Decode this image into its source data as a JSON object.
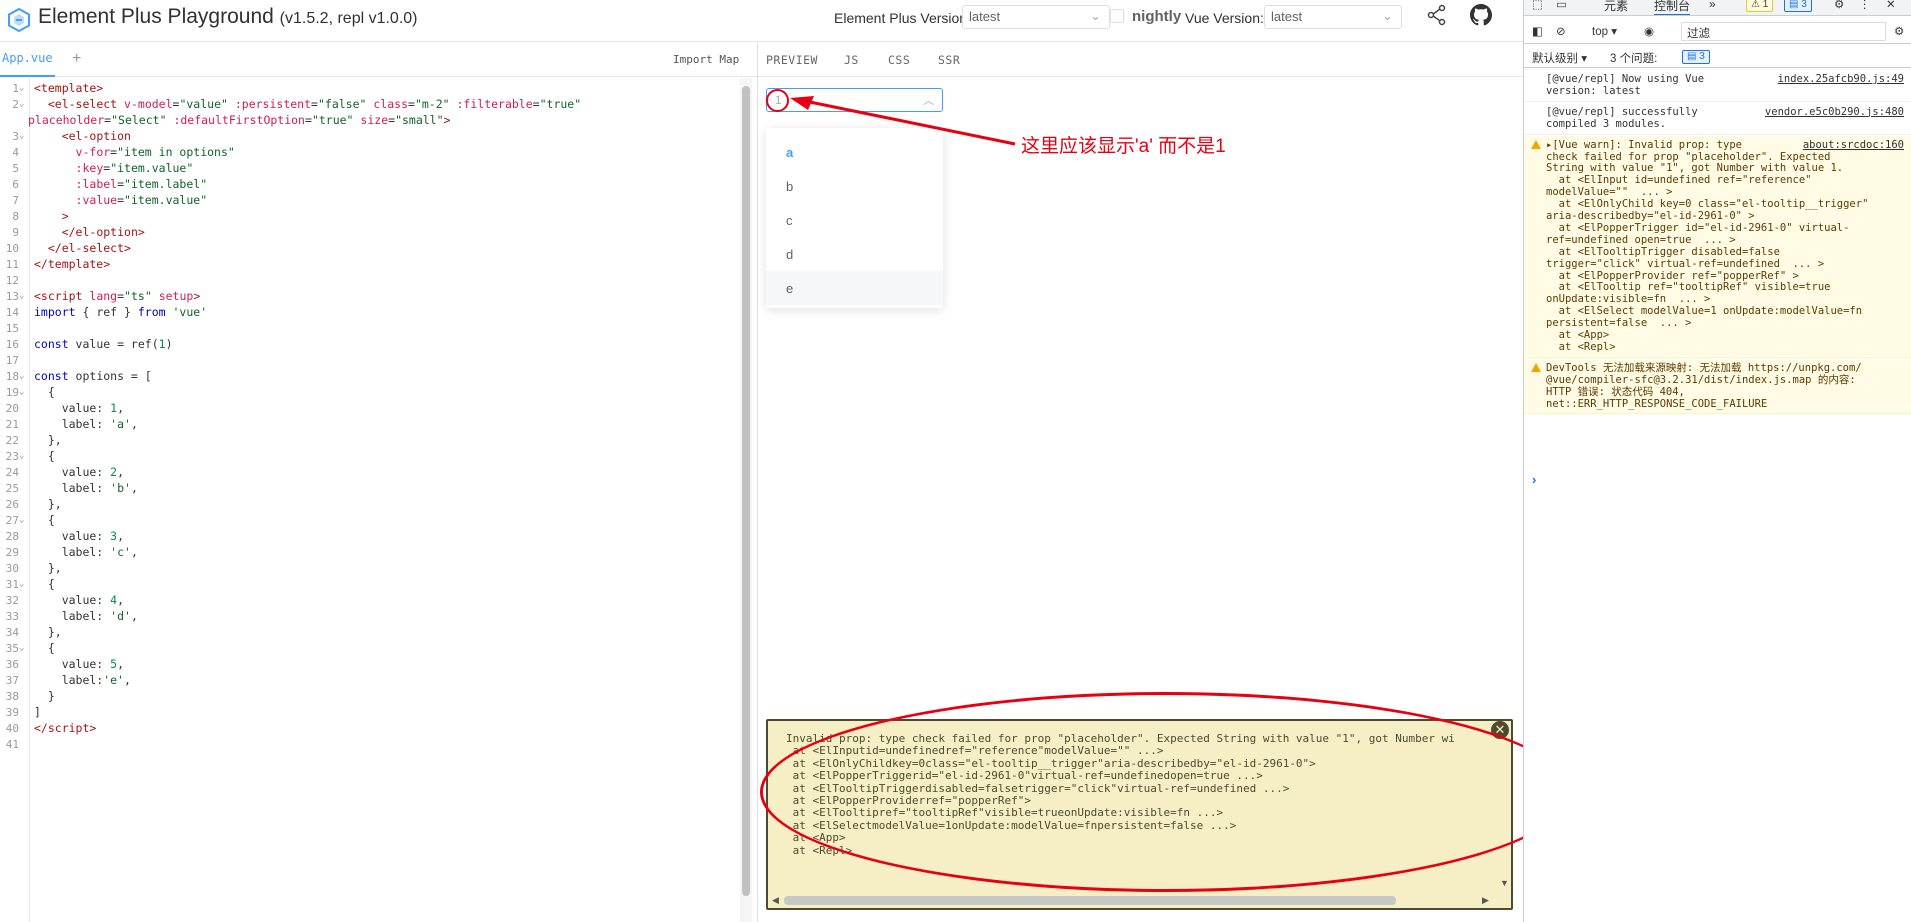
{
  "header": {
    "title": "Element Plus Playground",
    "version": "(v1.5.2, repl v1.0.0)",
    "ep_version_label": "Element Plus Version:",
    "ep_version_value": "latest",
    "nightly_label": "nightly",
    "vue_version_label": "Vue Version:",
    "vue_version_value": "latest"
  },
  "editor": {
    "file_tab": "App.vue",
    "add_label": "+",
    "import_map": "Import Map",
    "lines": [
      {
        "n": "1",
        "fold": true,
        "html": "<span class='tag'>&lt;template&gt;</span>"
      },
      {
        "n": "2",
        "fold": true,
        "html": "  <span class='tag'>&lt;el-select</span> <span class='attr'>v-model</span>=<span class='str'>\"value\"</span> <span class='attr'>:persistent</span>=<span class='str'>\"false\"</span> <span class='attr'>class</span>=<span class='str'>\"m-2\"</span> <span class='attr'>:filterable</span>=<span class='str'>\"true\"</span>"
      },
      {
        "n": "",
        "fold": false,
        "wrap": true,
        "html": "<span class='attr'>placeholder</span>=<span class='str'>\"Select\"</span> <span class='attr'>:defaultFirstOption</span>=<span class='str'>\"true\"</span> <span class='attr'>size</span>=<span class='str'>\"small\"</span><span class='tag'>&gt;</span>"
      },
      {
        "n": "3",
        "fold": true,
        "html": "    <span class='tag'>&lt;el-option</span>"
      },
      {
        "n": "4",
        "fold": false,
        "html": "      <span class='attr'>v-for</span>=<span class='str'>\"item in options\"</span>"
      },
      {
        "n": "5",
        "fold": false,
        "html": "      <span class='attr'>:key</span>=<span class='str'>\"item.value\"</span>"
      },
      {
        "n": "6",
        "fold": false,
        "html": "      <span class='attr'>:label</span>=<span class='str'>\"item.label\"</span>"
      },
      {
        "n": "7",
        "fold": false,
        "html": "      <span class='attr'>:value</span>=<span class='str'>\"item.value\"</span>"
      },
      {
        "n": "8",
        "fold": false,
        "html": "    <span class='tag'>&gt;</span>"
      },
      {
        "n": "9",
        "fold": false,
        "html": "    <span class='tag'>&lt;/el-option&gt;</span>"
      },
      {
        "n": "10",
        "fold": false,
        "html": "  <span class='tag'>&lt;/el-select&gt;</span>"
      },
      {
        "n": "11",
        "fold": false,
        "html": "<span class='tag'>&lt;/template&gt;</span>"
      },
      {
        "n": "12",
        "fold": false,
        "html": ""
      },
      {
        "n": "13",
        "fold": true,
        "html": "<span class='tag'>&lt;script</span> <span class='attr'>lang</span>=<span class='str'>\"ts\"</span> <span class='attr'>setup</span><span class='tag'>&gt;</span>"
      },
      {
        "n": "14",
        "fold": false,
        "html": "<span class='kw'>import</span> { ref } <span class='kw'>from</span> <span class='str'>'vue'</span>"
      },
      {
        "n": "15",
        "fold": false,
        "html": ""
      },
      {
        "n": "16",
        "fold": false,
        "html": "<span class='kw'>const</span> value = ref(<span class='num'>1</span>)"
      },
      {
        "n": "17",
        "fold": false,
        "html": ""
      },
      {
        "n": "18",
        "fold": true,
        "html": "<span class='kw'>const</span> options = ["
      },
      {
        "n": "19",
        "fold": true,
        "html": "  {"
      },
      {
        "n": "20",
        "fold": false,
        "html": "    value: <span class='num'>1</span>,"
      },
      {
        "n": "21",
        "fold": false,
        "html": "    label: <span class='str'>'a'</span>,"
      },
      {
        "n": "22",
        "fold": false,
        "html": "  },"
      },
      {
        "n": "23",
        "fold": true,
        "html": "  {"
      },
      {
        "n": "24",
        "fold": false,
        "html": "    value: <span class='num'>2</span>,"
      },
      {
        "n": "25",
        "fold": false,
        "html": "    label: <span class='str'>'b'</span>,"
      },
      {
        "n": "26",
        "fold": false,
        "html": "  },"
      },
      {
        "n": "27",
        "fold": true,
        "html": "  {"
      },
      {
        "n": "28",
        "fold": false,
        "html": "    value: <span class='num'>3</span>,"
      },
      {
        "n": "29",
        "fold": false,
        "html": "    label: <span class='str'>'c'</span>,"
      },
      {
        "n": "30",
        "fold": false,
        "html": "  },"
      },
      {
        "n": "31",
        "fold": true,
        "html": "  {"
      },
      {
        "n": "32",
        "fold": false,
        "html": "    value: <span class='num'>4</span>,"
      },
      {
        "n": "33",
        "fold": false,
        "html": "    label: <span class='str'>'d'</span>,"
      },
      {
        "n": "34",
        "fold": false,
        "html": "  },"
      },
      {
        "n": "35",
        "fold": true,
        "html": "  {"
      },
      {
        "n": "36",
        "fold": false,
        "html": "    value: <span class='num'>5</span>,"
      },
      {
        "n": "37",
        "fold": false,
        "html": "    label:<span class='str'>'e'</span>,"
      },
      {
        "n": "38",
        "fold": false,
        "html": "  }"
      },
      {
        "n": "39",
        "fold": false,
        "html": "]"
      },
      {
        "n": "40",
        "fold": false,
        "html": "<span class='tag'>&lt;/script&gt;</span>"
      },
      {
        "n": "41",
        "fold": false,
        "html": ""
      }
    ]
  },
  "preview": {
    "tabs": [
      "PREVIEW",
      "JS",
      "CSS",
      "SSR"
    ],
    "select_value": "1",
    "options": [
      "a",
      "b",
      "c",
      "d",
      "e"
    ],
    "annotation": "这里应该显示'a' 而不是1",
    "error_lines": [
      "Invalid prop: type check failed for prop \"placeholder\". Expected String with value \"1\", got Number wi",
      " at <ElInputid=undefinedref=\"reference\"modelValue=\"\" ...>",
      " at <ElOnlyChildkey=0class=\"el-tooltip__trigger\"aria-describedby=\"el-id-2961-0\">",
      " at <ElPopperTriggerid=\"el-id-2961-0\"virtual-ref=undefinedopen=true ...>",
      " at <ElTooltipTriggerdisabled=falsetrigger=\"click\"virtual-ref=undefined ...>",
      " at <ElPopperProviderref=\"popperRef\">",
      " at <ElTooltipref=\"tooltipRef\"visible=trueonUpdate:visible=fn ...>",
      " at <ElSelectmodelValue=1onUpdate:modelValue=fnpersistent=false ...>",
      " at <App>",
      " at <Repl>"
    ]
  },
  "devtools": {
    "tabs": [
      "元素",
      "控制台"
    ],
    "more": "»",
    "warn_count": "1",
    "info_count": "3",
    "context": "top",
    "filter_placeholder": "过滤",
    "level_label": "默认级别",
    "issues_label": "3 个问题:",
    "issues_count": "3",
    "logs": [
      {
        "type": "info",
        "text": "[@vue/repl] Now using Vue\nversion: latest",
        "src": "index.25afcb90.js:49"
      },
      {
        "type": "info",
        "text": "[@vue/repl] successfully\ncompiled 3 modules.",
        "src": "vendor.e5c0b290.js:480"
      },
      {
        "type": "warn",
        "text": "▸[Vue warn]: Invalid prop: type\ncheck failed for prop \"placeholder\". Expected\nString with value \"1\", got Number with value 1.\n  at <ElInput id=undefined ref=\"reference\"\nmodelValue=\"\"  ... >\n  at <ElOnlyChild key=0 class=\"el-tooltip__trigger\"\naria-describedby=\"el-id-2961-0\" >\n  at <ElPopperTrigger id=\"el-id-2961-0\" virtual-\nref=undefined open=true  ... >\n  at <ElTooltipTrigger disabled=false\ntrigger=\"click\" virtual-ref=undefined  ... >\n  at <ElPopperProvider ref=\"popperRef\" >\n  at <ElTooltip ref=\"tooltipRef\" visible=true\nonUpdate:visible=fn  ... >\n  at <ElSelect modelValue=1 onUpdate:modelValue=fn\npersistent=false  ... >\n  at <App>\n  at <Repl>",
        "src": "about:srcdoc:160"
      },
      {
        "type": "warn",
        "text": "DevTools 无法加载来源映射: 无法加载 https://unpkg.com/\n@vue/compiler-sfc@3.2.31/dist/index.js.map 的内容:\nHTTP 错误: 状态代码 404,\nnet::ERR_HTTP_RESPONSE_CODE_FAILURE",
        "src": ""
      }
    ],
    "prompt": "›"
  },
  "colors": {
    "accent": "#409eff",
    "annotation_red": "#e60012",
    "error_bg": "#f6efc5",
    "warn_bg": "#fffbe5"
  }
}
